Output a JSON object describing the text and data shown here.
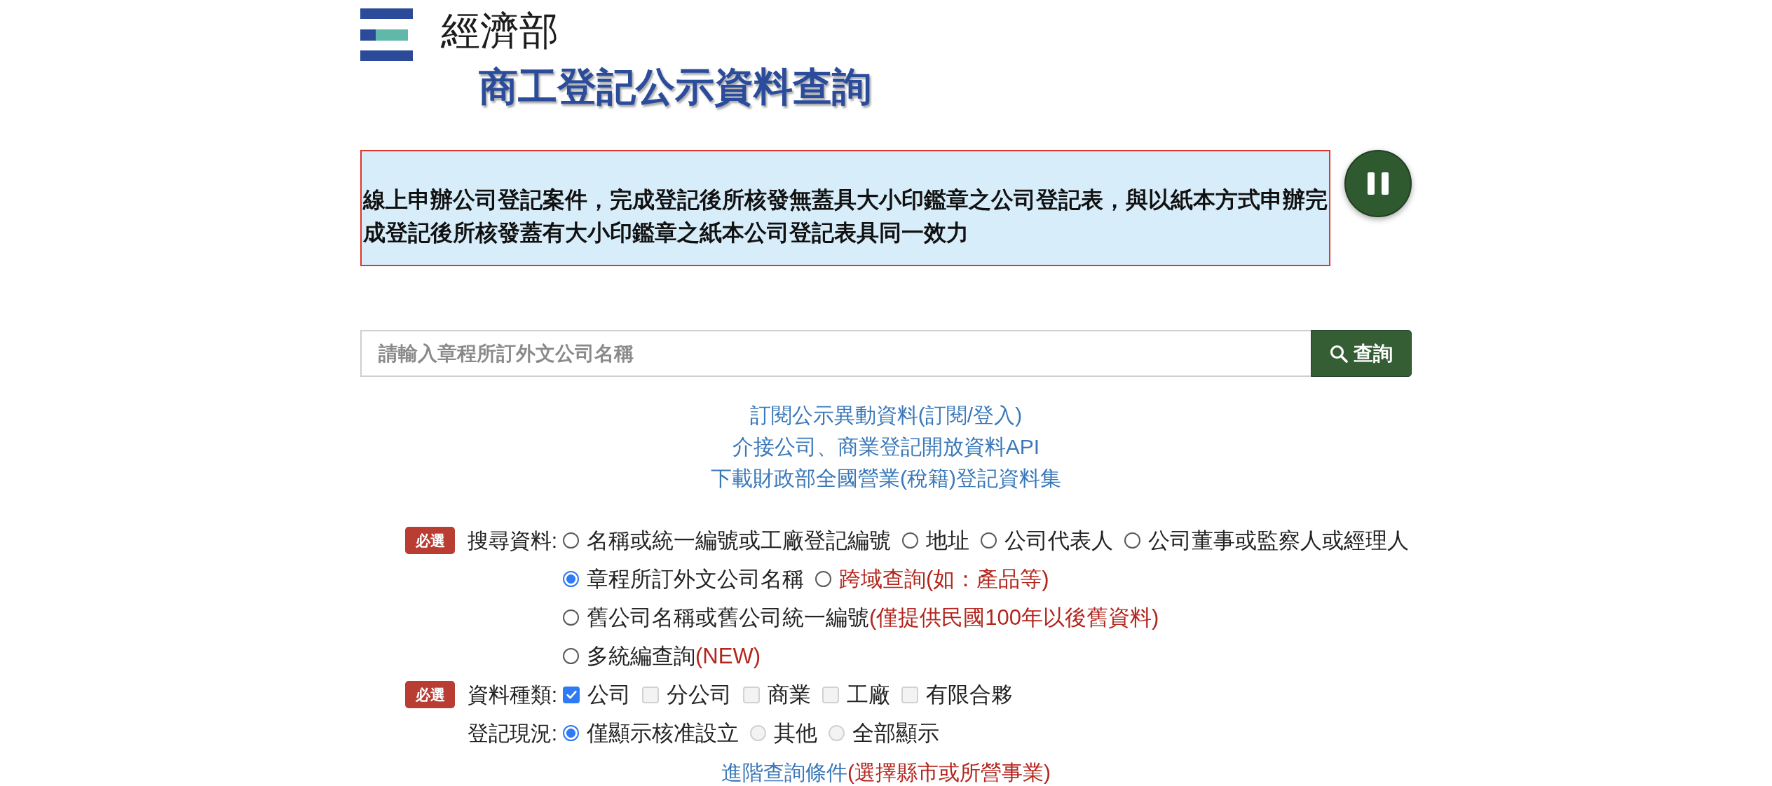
{
  "header": {
    "ministry": "經濟部",
    "title": "商工登記公示資料查詢"
  },
  "notice": {
    "text": "線上申辦公司登記案件，完成登記後所核發無蓋具大小印鑑章之公司登記表，與以紙本方式申辦完成登記後所核發蓋有大小印鑑章之紙本公司登記表具同一效力"
  },
  "search": {
    "placeholder": "請輸入章程所訂外文公司名稱",
    "button": "查詢"
  },
  "links": [
    "訂閱公示異動資料(訂閱/登入)",
    "介接公司、商業登記開放資料API",
    "下載財政部全國營業(稅籍)登記資料集"
  ],
  "filters": [
    {
      "badge": "必選",
      "label": "搜尋資料:",
      "kind": "radio",
      "rows": [
        [
          {
            "label": "名稱或統一編號或工廠登記編號",
            "selected": false,
            "disabled": false
          },
          {
            "label": "地址",
            "selected": false,
            "disabled": false
          },
          {
            "label": "公司代表人",
            "selected": false,
            "disabled": false
          },
          {
            "label": "公司董事或監察人或經理人",
            "selected": false,
            "disabled": false
          }
        ],
        [
          {
            "label": "章程所訂外文公司名稱",
            "selected": true,
            "disabled": false
          },
          {
            "note": "跨域查詢(如：產品等)",
            "selected": false,
            "disabled": false
          }
        ],
        [
          {
            "label": "舊公司名稱或舊公司統一編號",
            "note": "(僅提供民國100年以後舊資料)",
            "selected": false,
            "disabled": false
          }
        ],
        [
          {
            "label": "多統編查詢",
            "note": "(NEW)",
            "selected": false,
            "disabled": false
          }
        ]
      ]
    },
    {
      "badge": "必選",
      "label": "資料種類:",
      "kind": "checkbox",
      "rows": [
        [
          {
            "label": "公司",
            "checked": true,
            "disabled": false
          },
          {
            "label": "分公司",
            "checked": false,
            "disabled": true
          },
          {
            "label": "商業",
            "checked": false,
            "disabled": true
          },
          {
            "label": "工廠",
            "checked": false,
            "disabled": true
          },
          {
            "label": "有限合夥",
            "checked": false,
            "disabled": true
          }
        ]
      ]
    },
    {
      "label": "登記現況:",
      "kind": "radio",
      "rows": [
        [
          {
            "label": "僅顯示核准設立",
            "selected": true,
            "disabled": false
          },
          {
            "label": "其他",
            "selected": false,
            "disabled": true
          },
          {
            "label": "全部顯示",
            "selected": false,
            "disabled": true
          }
        ]
      ]
    }
  ],
  "advanced": {
    "label": "進階查詢條件",
    "note": "(選擇縣市或所營事業)"
  }
}
